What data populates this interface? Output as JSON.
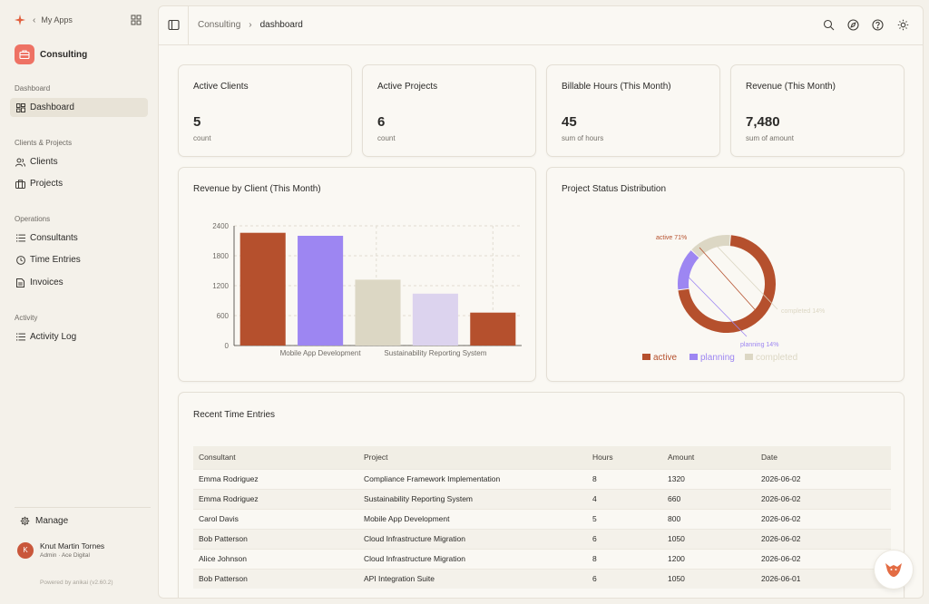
{
  "sidebar": {
    "my_apps": "My Apps",
    "app_name": "Consulting",
    "sections": [
      {
        "label": "Dashboard",
        "items": [
          {
            "label": "Dashboard",
            "icon": "dashboard-grid-icon",
            "active": true
          }
        ]
      },
      {
        "label": "Clients & Projects",
        "items": [
          {
            "label": "Clients",
            "icon": "users-icon"
          },
          {
            "label": "Projects",
            "icon": "briefcase-icon"
          }
        ]
      },
      {
        "label": "Operations",
        "items": [
          {
            "label": "Consultants",
            "icon": "list-icon"
          },
          {
            "label": "Time Entries",
            "icon": "clock-icon"
          },
          {
            "label": "Invoices",
            "icon": "file-icon"
          }
        ]
      },
      {
        "label": "Activity",
        "items": [
          {
            "label": "Activity Log",
            "icon": "list-icon"
          }
        ]
      }
    ],
    "manage": "Manage",
    "user": {
      "initial": "K",
      "name": "Knut Martin Tornes",
      "role": "Admin · Ace Digital"
    },
    "powered_by": "Powered by anikai (v2.60.2)"
  },
  "header": {
    "breadcrumb_parent": "Consulting",
    "breadcrumb_current": "dashboard"
  },
  "stats": [
    {
      "title": "Active Clients",
      "value": "5",
      "sub": "count"
    },
    {
      "title": "Active Projects",
      "value": "6",
      "sub": "count"
    },
    {
      "title": "Billable Hours (This Month)",
      "value": "45",
      "sub": "sum of hours"
    },
    {
      "title": "Revenue (This Month)",
      "value": "7,480",
      "sub": "sum of amount"
    }
  ],
  "revenue_chart": {
    "title": "Revenue by Client (This Month)"
  },
  "status_chart": {
    "title": "Project Status Distribution"
  },
  "chart_data": [
    {
      "type": "bar",
      "title": "Revenue by Client (This Month)",
      "categories": [
        "",
        "Mobile App Development",
        "",
        "Sustainability Reporting System",
        ""
      ],
      "values": [
        2260,
        2200,
        1320,
        1040,
        660
      ],
      "colors": [
        "#b5502d",
        "#9d86f2",
        "#dcd7c4",
        "#dcd3ee",
        "#b5502d"
      ],
      "yticks": [
        0,
        600,
        1200,
        1800,
        2400
      ],
      "ylim": [
        0,
        2400
      ],
      "grid": true
    },
    {
      "type": "pie",
      "title": "Project Status Distribution",
      "labels": [
        "active",
        "planning",
        "completed"
      ],
      "values": [
        71,
        14,
        14
      ],
      "slice_labels": [
        "active 71%",
        "planning 14%",
        "completed 14%"
      ],
      "colors": [
        "#b5502d",
        "#9d86f2",
        "#dcd7c4"
      ],
      "legend": "bottom"
    }
  ],
  "time_entries": {
    "title": "Recent Time Entries",
    "columns": [
      "Consultant",
      "Project",
      "Hours",
      "Amount",
      "Date"
    ],
    "rows": [
      [
        "Emma Rodriguez",
        "Compliance Framework Implementation",
        "8",
        "1320",
        "2026-06-02"
      ],
      [
        "Emma Rodriguez",
        "Sustainability Reporting System",
        "4",
        "660",
        "2026-06-02"
      ],
      [
        "Carol Davis",
        "Mobile App Development",
        "5",
        "800",
        "2026-06-02"
      ],
      [
        "Bob Patterson",
        "Cloud Infrastructure Migration",
        "6",
        "1050",
        "2026-06-02"
      ],
      [
        "Alice Johnson",
        "Cloud Infrastructure Migration",
        "8",
        "1200",
        "2026-06-02"
      ],
      [
        "Bob Patterson",
        "API Integration Suite",
        "6",
        "1050",
        "2026-06-01"
      ]
    ]
  },
  "colors": {
    "accent": "#b5502d",
    "brand": "#ee7264"
  }
}
